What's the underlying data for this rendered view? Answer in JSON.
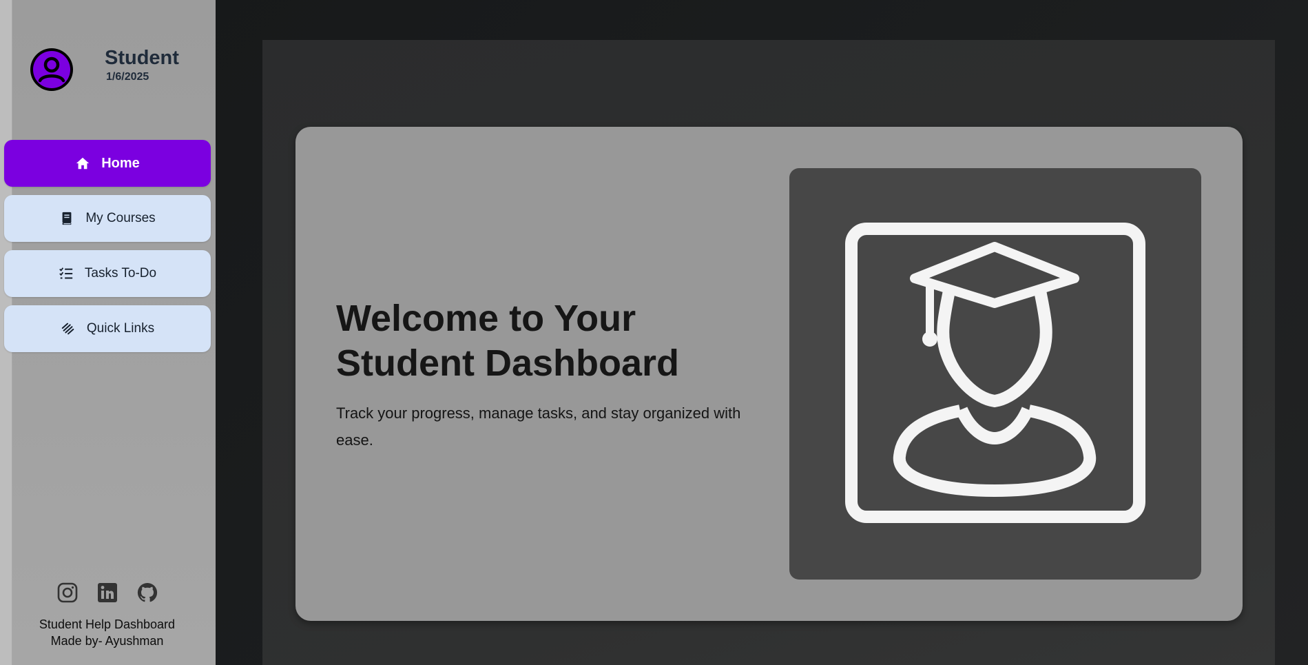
{
  "profile": {
    "name": "Student",
    "date": "1/6/2025",
    "avatar_icon": "user-circle-icon",
    "avatar_color": "#7b00e0"
  },
  "nav": {
    "items": [
      {
        "label": "Home",
        "icon": "home-icon",
        "active": true
      },
      {
        "label": "My Courses",
        "icon": "book-icon",
        "active": false
      },
      {
        "label": "Tasks To-Do",
        "icon": "checklist-icon",
        "active": false
      },
      {
        "label": "Quick Links",
        "icon": "link-icon",
        "active": false
      }
    ]
  },
  "social": [
    "instagram-icon",
    "linkedin-icon",
    "github-icon"
  ],
  "footer": {
    "line1": "Student Help Dashboard",
    "line2": "Made by- Ayushman"
  },
  "hero": {
    "title": "Welcome to Your Student Dashboard",
    "subtitle": "Track your progress, manage tasks, and stay organized with ease.",
    "image_icon": "graduate-student-icon"
  },
  "colors": {
    "accent": "#7b00e0",
    "nav_item_bg": "#d5e3f7",
    "hero_bg": "#989898"
  }
}
